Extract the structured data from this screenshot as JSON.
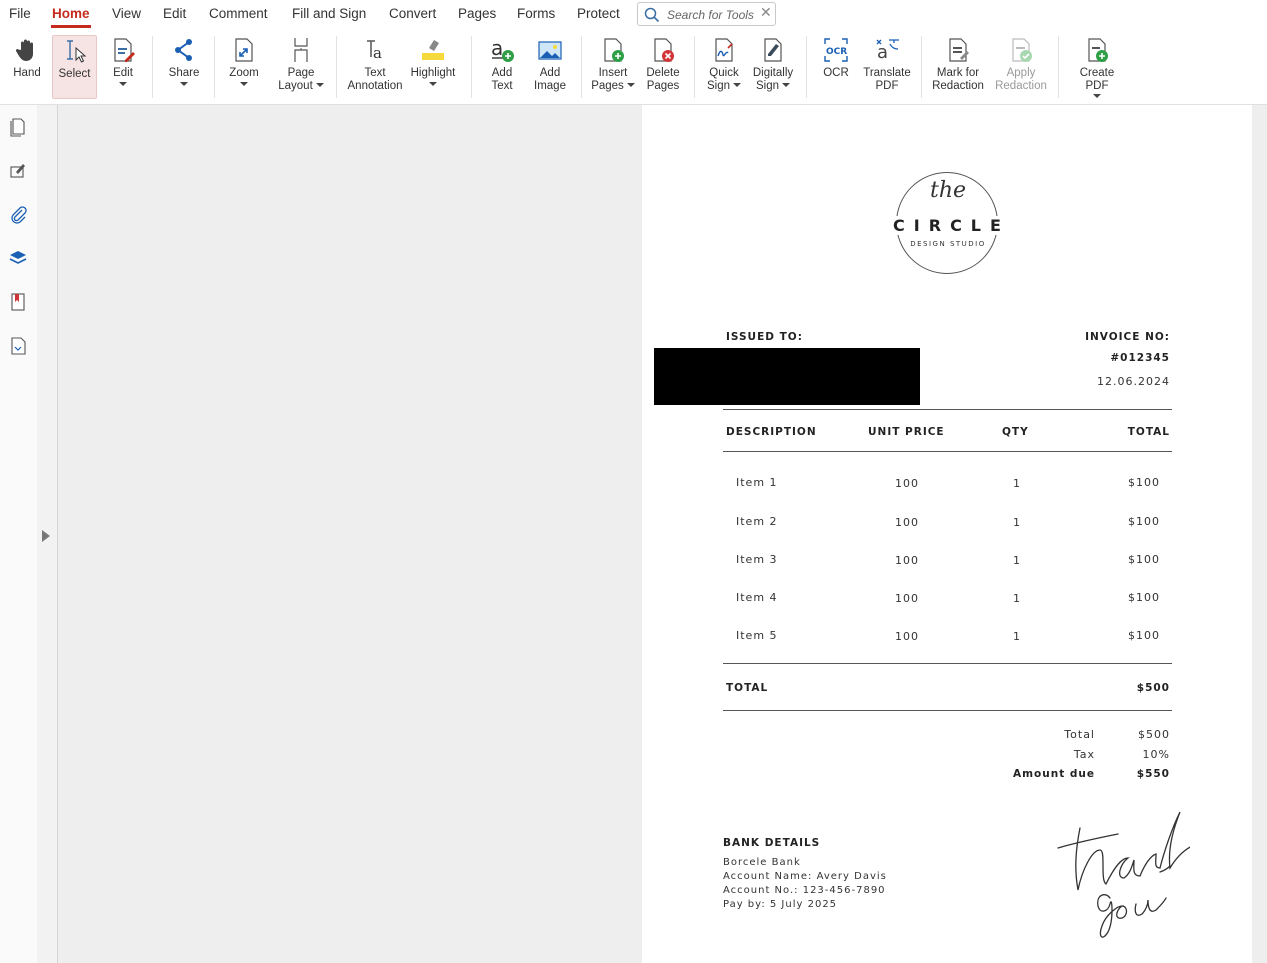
{
  "menu": {
    "items": [
      "File",
      "Home",
      "View",
      "Edit",
      "Comment",
      "Fill and Sign",
      "Convert",
      "Pages",
      "Forms",
      "Protect"
    ],
    "active": "Home",
    "search_placeholder": "Search for Tools"
  },
  "ribbon": {
    "hand": "Hand",
    "select": "Select",
    "edit": "Edit",
    "share": "Share",
    "zoom": "Zoom",
    "page_layout_1": "Page",
    "page_layout_2": "Layout",
    "text_annotation_1": "Text",
    "text_annotation_2": "Annotation",
    "highlight": "Highlight",
    "add_text_1": "Add",
    "add_text_2": "Text",
    "add_image_1": "Add",
    "add_image_2": "Image",
    "insert_pages_1": "Insert",
    "insert_pages_2": "Pages",
    "delete_pages_1": "Delete",
    "delete_pages_2": "Pages",
    "quick_sign_1": "Quick",
    "quick_sign_2": "Sign",
    "digitally_sign_1": "Digitally",
    "digitally_sign_2": "Sign",
    "ocr": "OCR",
    "translate_1": "Translate",
    "translate_2": "PDF",
    "mark_redaction_1": "Mark for",
    "mark_redaction_2": "Redaction",
    "apply_redaction_1": "Apply",
    "apply_redaction_2": "Redaction",
    "create_pdf": "Create PDF"
  },
  "invoice": {
    "logo_the": "the",
    "logo_name": "CIRCLE",
    "logo_sub": "DESIGN STUDIO",
    "issued_to": "ISSUED TO:",
    "invoice_no_label": "INVOICE NO:",
    "invoice_no": "#012345",
    "date": "12.06.2024",
    "columns": [
      "DESCRIPTION",
      "UNIT PRICE",
      "QTY",
      "TOTAL"
    ],
    "rows": [
      {
        "desc": "Item 1",
        "price": "100",
        "qty": "1",
        "total": "$100"
      },
      {
        "desc": "Item 2",
        "price": "100",
        "qty": "1",
        "total": "$100"
      },
      {
        "desc": "Item 3",
        "price": "100",
        "qty": "1",
        "total": "$100"
      },
      {
        "desc": "Item 4",
        "price": "100",
        "qty": "1",
        "total": "$100"
      },
      {
        "desc": "Item 5",
        "price": "100",
        "qty": "1",
        "total": "$100"
      }
    ],
    "total_label": "TOTAL",
    "total_value": "$500",
    "summary": {
      "total_label": "Total",
      "total_value": "$500",
      "tax_label": "Tax",
      "tax_value": "10%",
      "due_label": "Amount due",
      "due_value": "$550"
    },
    "bank": {
      "title": "BANK DETAILS",
      "bank_name": "Borcele Bank",
      "account_name": "Account Name: Avery Davis",
      "account_no": "Account No.: 123-456-7890",
      "pay_by": "Pay by: 5 July 2025"
    },
    "thank_you": "thank you"
  }
}
